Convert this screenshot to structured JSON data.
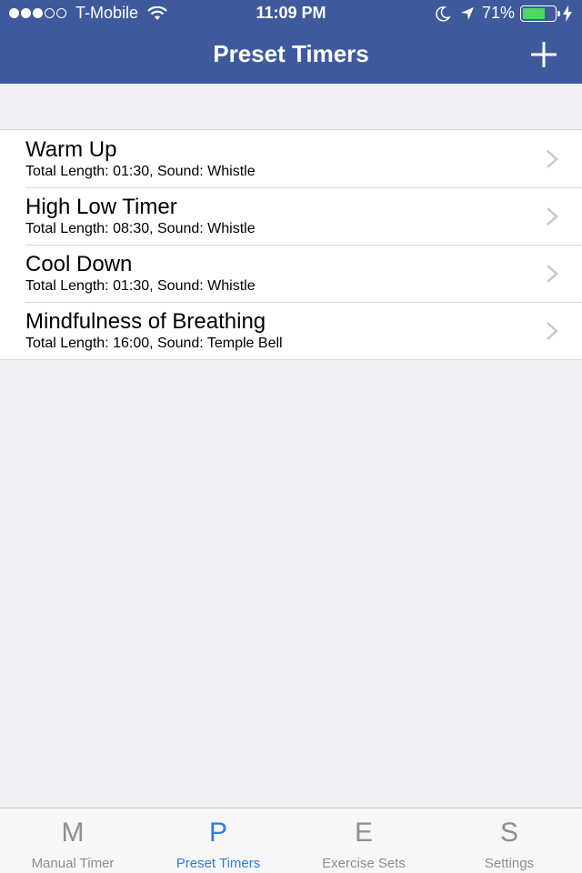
{
  "status_bar": {
    "carrier": "T-Mobile",
    "time": "11:09 PM",
    "battery_percent": "71%",
    "battery_level": 0.71,
    "signal_bars_filled": 3,
    "signal_bars_total": 5
  },
  "nav": {
    "title": "Preset Timers",
    "add_icon": "plus-icon"
  },
  "timers": [
    {
      "name": "Warm Up",
      "detail": "Total Length: 01:30, Sound: Whistle"
    },
    {
      "name": "High Low Timer",
      "detail": "Total Length: 08:30, Sound: Whistle"
    },
    {
      "name": "Cool Down",
      "detail": "Total Length: 01:30, Sound: Whistle"
    },
    {
      "name": "Mindfulness of Breathing",
      "detail": "Total Length: 16:00, Sound: Temple Bell"
    }
  ],
  "tabs": [
    {
      "letter": "M",
      "label": "Manual Timer",
      "active": false
    },
    {
      "letter": "P",
      "label": "Preset Timers",
      "active": true
    },
    {
      "letter": "E",
      "label": "Exercise Sets",
      "active": false
    },
    {
      "letter": "S",
      "label": "Settings",
      "active": false
    }
  ],
  "colors": {
    "nav_background": "#3f5a9c",
    "tab_active": "#2c7ce0",
    "tab_inactive": "#8e8e93",
    "battery_green": "#4cd964",
    "background": "#efeff4"
  }
}
